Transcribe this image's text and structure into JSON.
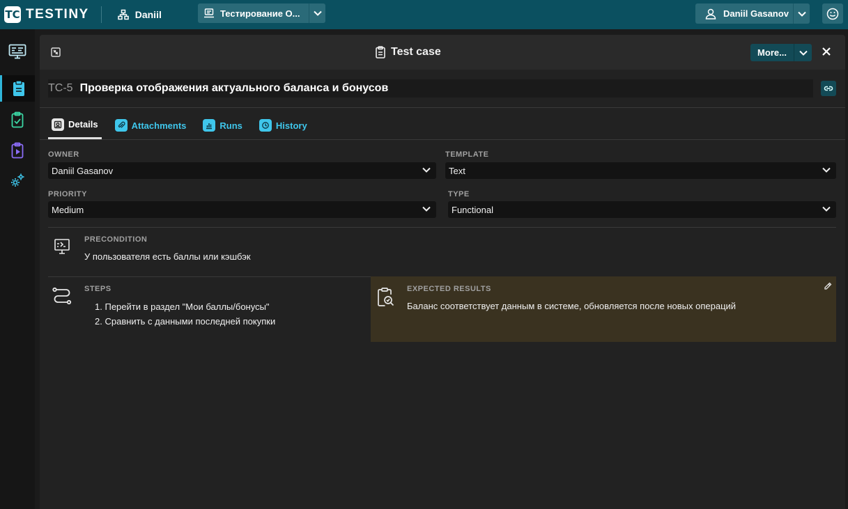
{
  "topbar": {
    "logo_mark": "TC",
    "logo_text": "TESTINY",
    "org_name": "Daniil",
    "project_name": "Тестирование О...",
    "user_name": "Daniil Gasanov"
  },
  "panel": {
    "title": "Test case",
    "more_label": "More...",
    "testcase_id": "TC-5",
    "testcase_title": "Проверка отображения актуального баланса и бонусов"
  },
  "tabs": [
    {
      "label": "Details",
      "icon": "details-icon",
      "active": true
    },
    {
      "label": "Attachments",
      "icon": "paperclip-icon"
    },
    {
      "label": "Runs",
      "icon": "bar-chart-icon"
    },
    {
      "label": "History",
      "icon": "history-icon"
    }
  ],
  "fields": {
    "owner": {
      "label": "OWNER",
      "value": "Daniil Gasanov"
    },
    "template": {
      "label": "TEMPLATE",
      "value": "Text"
    },
    "priority": {
      "label": "PRIORITY",
      "value": "Medium"
    },
    "type": {
      "label": "TYPE",
      "value": "Functional"
    }
  },
  "precondition": {
    "label": "PRECONDITION",
    "text": "У пользователя есть баллы или кэшбэк"
  },
  "steps": {
    "label": "STEPS",
    "items": [
      "Перейти в раздел \"Мои баллы/бонусы\"",
      "Сравнить с данными последней покупки"
    ]
  },
  "expected": {
    "label": "EXPECTED RESULTS",
    "text": "Баланс соответствует данным в системе, обновляется после новых операций"
  },
  "colors": {
    "topbar": "#0b5060",
    "accent": "#3fc6eb",
    "expected_bg": "#3a3220"
  }
}
